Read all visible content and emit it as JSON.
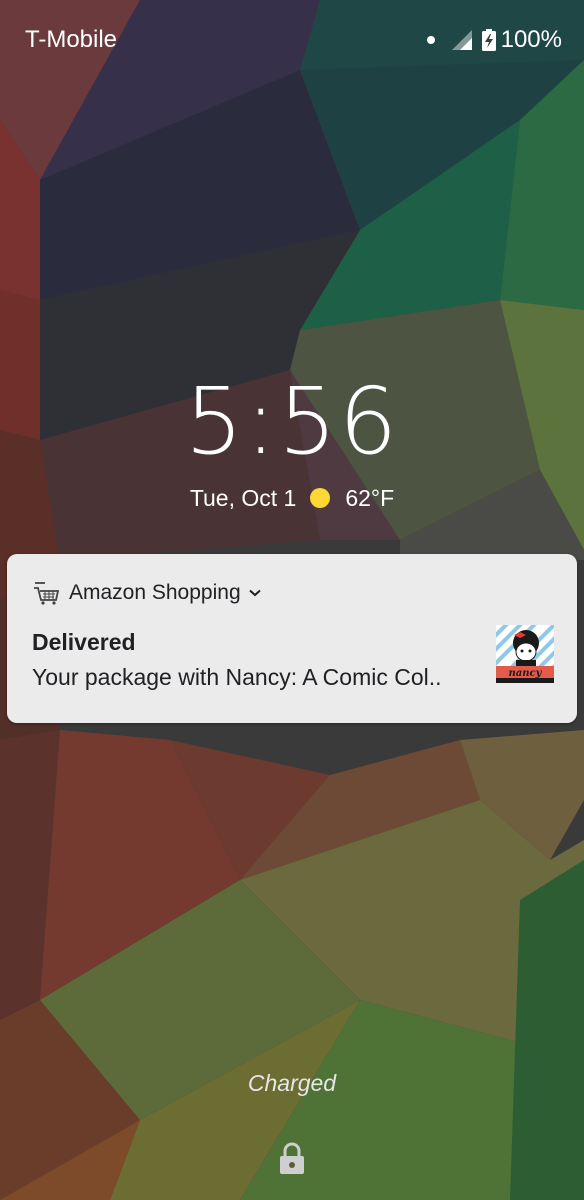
{
  "status_bar": {
    "carrier": "T-Mobile",
    "battery_percent": "100%",
    "icons": [
      "notification-dot-icon",
      "signal-icon",
      "battery-charging-icon"
    ]
  },
  "lockscreen": {
    "time": "5:56",
    "date": "Tue, Oct 1",
    "weather_icon": "sun-icon",
    "temperature": "62°F",
    "charging_status": "Charged",
    "lock_icon": "lock-icon"
  },
  "notification": {
    "app_icon": "amazon-cart-icon",
    "app_name": "Amazon Shopping",
    "expand_icon": "chevron-down-icon",
    "title": "Delivered",
    "text": "Your package with Nancy: A Comic Col..",
    "thumbnail": "nancy-book-thumbnail"
  },
  "colors": {
    "notification_background": "#ebebeb",
    "sun": "#fdd835",
    "text_light": "#ffffff",
    "text_dark": "#202124"
  }
}
